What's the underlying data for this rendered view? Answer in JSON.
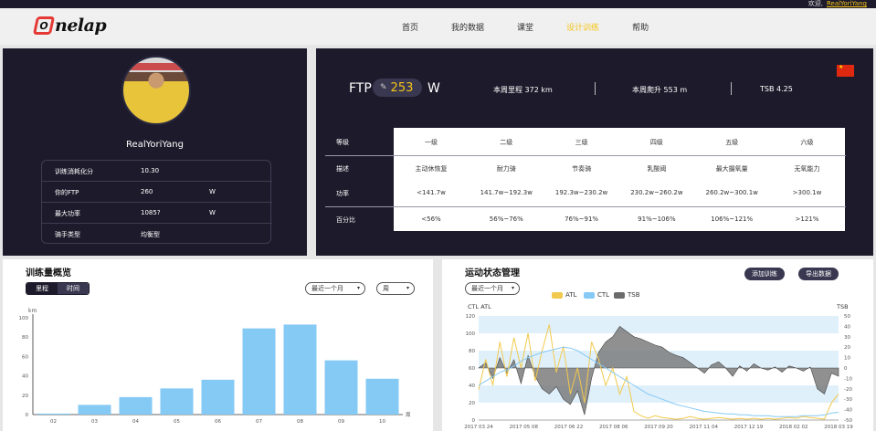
{
  "topbar": {
    "welcome": "欢迎,",
    "user": "RealYoriYang"
  },
  "logo": {
    "mark": "O",
    "text": "nelap"
  },
  "nav": [
    "首页",
    "我的数据",
    "课堂",
    "设计训练",
    "帮助"
  ],
  "nav_active_index": 3,
  "profile": {
    "username": "RealYoriYang",
    "rows": [
      {
        "label": "训练消耗化分",
        "value": "10.30",
        "unit": ""
      },
      {
        "label": "你的FTP",
        "value": "260",
        "unit": "W"
      },
      {
        "label": "最大功率",
        "value": "1085?",
        "unit": "W"
      },
      {
        "label": "骑手类型",
        "value": "均衡型",
        "unit": ""
      }
    ]
  },
  "ftp": {
    "label": "FTP",
    "edit_icon": "edit-icon",
    "value": "253",
    "unit": "W",
    "stats": [
      "本周里程  372 km",
      "本周爬升  553 m",
      "TSB  4.25"
    ],
    "zones": {
      "row_labels": [
        "等级",
        "描述",
        "功率",
        "百分比"
      ],
      "levels": [
        "一级",
        "二级",
        "三级",
        "四级",
        "五级",
        "六级"
      ],
      "descriptions": [
        "主动休恢复",
        "耐力骑",
        "节奏骑",
        "乳酸阈",
        "最大摄氧量",
        "无氧能力"
      ],
      "powers": [
        "<141.7w",
        "141.7w~192.3w",
        "192.3w~230.2w",
        "230.2w~260.2w",
        "260.2w~300.1w",
        ">300.1w"
      ],
      "percents": [
        "<56%",
        "56%~76%",
        "76%~91%",
        "91%~106%",
        "106%~121%",
        ">121%"
      ]
    }
  },
  "volume": {
    "title": "训练量概览",
    "seg": [
      "里程",
      "时间"
    ],
    "period_dd": "最近一个月",
    "unit_dd": "周",
    "chart_data": {
      "type": "bar",
      "ylabel": "km",
      "ylim": [
        0,
        100
      ],
      "yticks": [
        0,
        20,
        40,
        60,
        80,
        100
      ],
      "categories": [
        "02",
        "03",
        "04",
        "05",
        "06",
        "07",
        "08",
        "09",
        "10"
      ],
      "values": [
        1,
        10,
        18,
        27,
        36,
        89,
        93,
        56,
        37
      ],
      "xlabel_end": "周",
      "color": "#85c9f5"
    }
  },
  "status": {
    "title": "运动状态管理",
    "add_button": "添加训练",
    "data_button": "导出数据",
    "period_dd": "最近一个月",
    "legend": [
      {
        "name": "ATL",
        "color": "#f2c94c"
      },
      {
        "name": "CTL",
        "color": "#85c9f5"
      },
      {
        "name": "TSB",
        "color": "#6b6b6b"
      }
    ],
    "chart_data": {
      "type": "line",
      "left_axis_label": "CTL ATL",
      "right_axis_label": "TSB",
      "left_ticks": [
        0,
        20,
        40,
        60,
        80,
        100,
        120
      ],
      "right_ticks": [
        -50,
        -40,
        -30,
        -20,
        -10,
        0,
        10,
        20,
        30,
        40,
        50
      ],
      "x_ticks": [
        "2017 03 24",
        "2017 05 08",
        "2017 06 22",
        "2017 08 06",
        "2017 09 20",
        "2017 11 04",
        "2017 12 19",
        "2018 02 02",
        "2018 03 19"
      ],
      "series": [
        {
          "name": "ATL",
          "values": [
            35,
            70,
            40,
            90,
            50,
            95,
            60,
            100,
            45,
            80,
            110,
            55,
            85,
            30,
            60,
            20,
            90,
            70,
            40,
            60,
            30,
            50,
            10,
            5,
            2,
            5,
            3,
            2,
            1,
            2,
            4,
            2,
            1,
            2,
            3,
            2,
            1,
            2,
            1,
            2,
            1,
            2,
            1,
            2,
            3,
            2,
            4,
            3,
            2,
            1,
            20,
            30
          ]
        },
        {
          "name": "CTL",
          "values": [
            40,
            45,
            50,
            55,
            58,
            62,
            68,
            72,
            75,
            78,
            80,
            82,
            84,
            83,
            80,
            75,
            70,
            65,
            60,
            55,
            50,
            45,
            40,
            35,
            30,
            27,
            24,
            21,
            18,
            16,
            14,
            12,
            10,
            9,
            8,
            7,
            7,
            6,
            6,
            5,
            5,
            5,
            4,
            4,
            4,
            4,
            5,
            5,
            5,
            6,
            8,
            9
          ]
        },
        {
          "name": "TSB",
          "values": [
            0,
            5,
            -10,
            10,
            -5,
            8,
            -15,
            12,
            -8,
            -20,
            -25,
            -18,
            -30,
            -35,
            -22,
            -45,
            -10,
            15,
            25,
            30,
            40,
            35,
            30,
            28,
            25,
            22,
            20,
            15,
            12,
            10,
            5,
            0,
            -5,
            3,
            6,
            0,
            -8,
            2,
            -3,
            4,
            0,
            -2,
            1,
            -4,
            2,
            0,
            -3,
            1,
            -20,
            -25,
            -5,
            -8
          ]
        }
      ]
    }
  },
  "colors": {
    "dark": "#1d1b2b",
    "accent": "#f5c518",
    "bar": "#85c9f5"
  }
}
